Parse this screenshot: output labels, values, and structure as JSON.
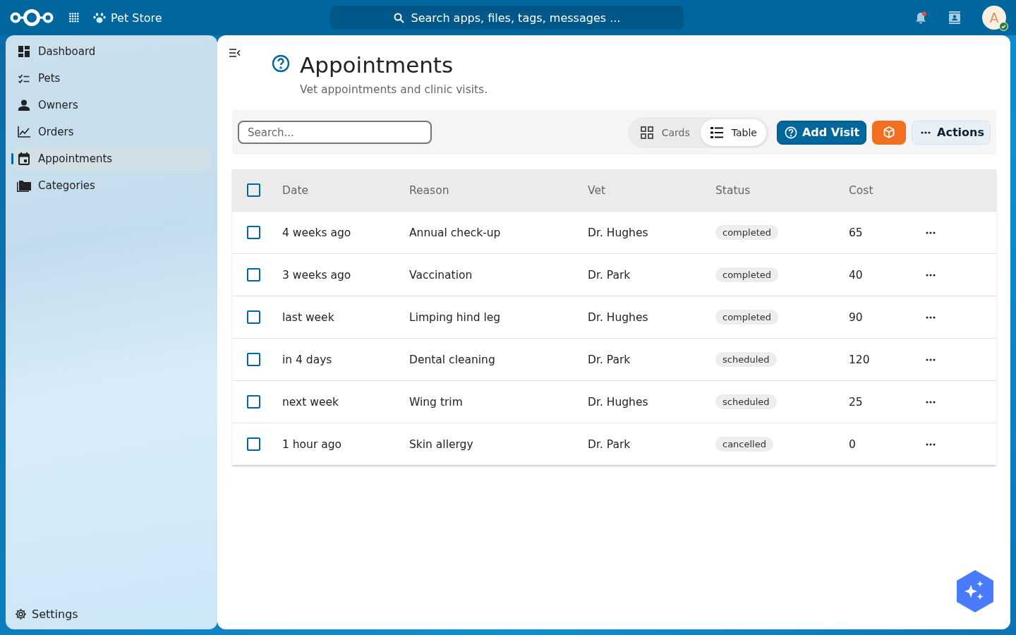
{
  "header": {
    "app_name": "Pet Store",
    "search": {
      "placeholder": "Search apps, files, tags, messages ..."
    },
    "notifications": {
      "unread": true
    },
    "avatar": {
      "initial": "A",
      "online": true
    }
  },
  "navigation": {
    "items": [
      {
        "label": "Dashboard",
        "selected": false
      },
      {
        "label": "Pets",
        "selected": false
      },
      {
        "label": "Owners",
        "selected": false
      },
      {
        "label": "Orders",
        "selected": false
      },
      {
        "label": "Appointments",
        "selected": true
      },
      {
        "label": "Categories",
        "selected": false
      }
    ],
    "settings": "Settings"
  },
  "page": {
    "title": "Appointments",
    "subtitle": "Vet appointments and clinic visits."
  },
  "toolbar": {
    "search": {
      "placeholder": "Search..."
    },
    "views": [
      {
        "label": "Cards",
        "selected": false
      },
      {
        "label": "Table",
        "selected": true
      }
    ],
    "add_button": "Add Visit",
    "actions_button": "Actions"
  },
  "table": {
    "select_all": {
      "checked": false
    },
    "columns": [
      "Date",
      "Reason",
      "Vet",
      "Status",
      "Cost"
    ],
    "rows": [
      {
        "checked": false,
        "date": "4 weeks ago",
        "reason": "Annual check-up",
        "vet": "Dr. Hughes",
        "status": "completed",
        "cost": "65"
      },
      {
        "checked": false,
        "date": "3 weeks ago",
        "reason": "Vaccination",
        "vet": "Dr. Park",
        "status": "completed",
        "cost": "40"
      },
      {
        "checked": false,
        "date": "last week",
        "reason": "Limping hind leg",
        "vet": "Dr. Hughes",
        "status": "completed",
        "cost": "90"
      },
      {
        "checked": false,
        "date": "in 4 days",
        "reason": "Dental cleaning",
        "vet": "Dr. Park",
        "status": "scheduled",
        "cost": "120"
      },
      {
        "checked": false,
        "date": "next week",
        "reason": "Wing trim",
        "vet": "Dr. Hughes",
        "status": "scheduled",
        "cost": "25"
      },
      {
        "checked": false,
        "date": "1 hour ago",
        "reason": "Skin allergy",
        "vet": "Dr. Park",
        "status": "cancelled",
        "cost": "0"
      }
    ]
  }
}
